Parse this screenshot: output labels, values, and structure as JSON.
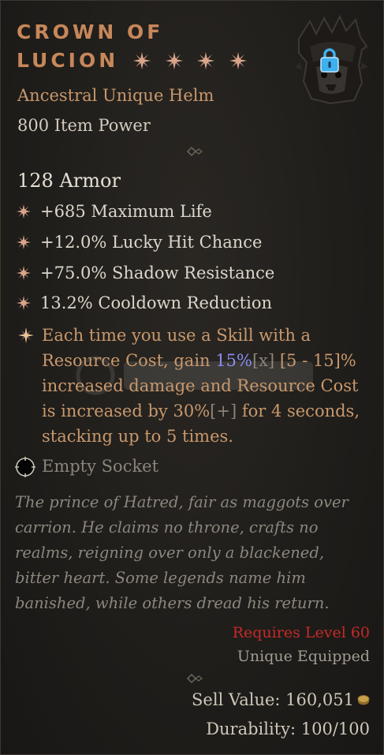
{
  "item": {
    "name_line1": "CROWN OF",
    "name_line2": "LUCION",
    "greater_affix_stars": 4,
    "type": "Ancestral Unique Helm",
    "item_power": "800 Item Power",
    "armor": "128 Armor",
    "affixes": [
      "+685 Maximum Life",
      "+12.0% Lucky Hit Chance",
      "+75.0% Shadow Resistance",
      "13.2% Cooldown Reduction"
    ],
    "unique_power": {
      "part1": "Each time you use a Skill with a Resource Cost, gain ",
      "value1": "15%",
      "bracket1": "[x]",
      "range1": " [5 - 15]% increased damage and Resource Cost is increased by ",
      "value2": "30%",
      "bracket2": "[+]",
      "part2": " for 4 seconds, stacking up to 5 times."
    },
    "socket": "Empty Socket",
    "lore": "The prince of Hatred, fair as maggots over carrion. He claims no throne, crafts no realms, reigning over only a blackened, bitter heart. Some legends name him banished, while others dread his return.",
    "requires": "Requires Level 60",
    "unique_equipped": "Unique Equipped",
    "sell_value": "Sell Value: 160,051",
    "durability": "Durability: 100/100"
  },
  "icons": {
    "helm": "helm-icon",
    "lock": "lock-icon",
    "affix_bullet": "affix-bullet-icon",
    "unique_bullet": "unique-bullet-icon",
    "socket": "socket-icon",
    "coin": "gold-coin-icon"
  },
  "colors": {
    "title": "#c7875a",
    "type": "#c8986c",
    "highlight": "#8a8cf0",
    "requires": "#c42a27",
    "bullet": "#d9a48a"
  }
}
